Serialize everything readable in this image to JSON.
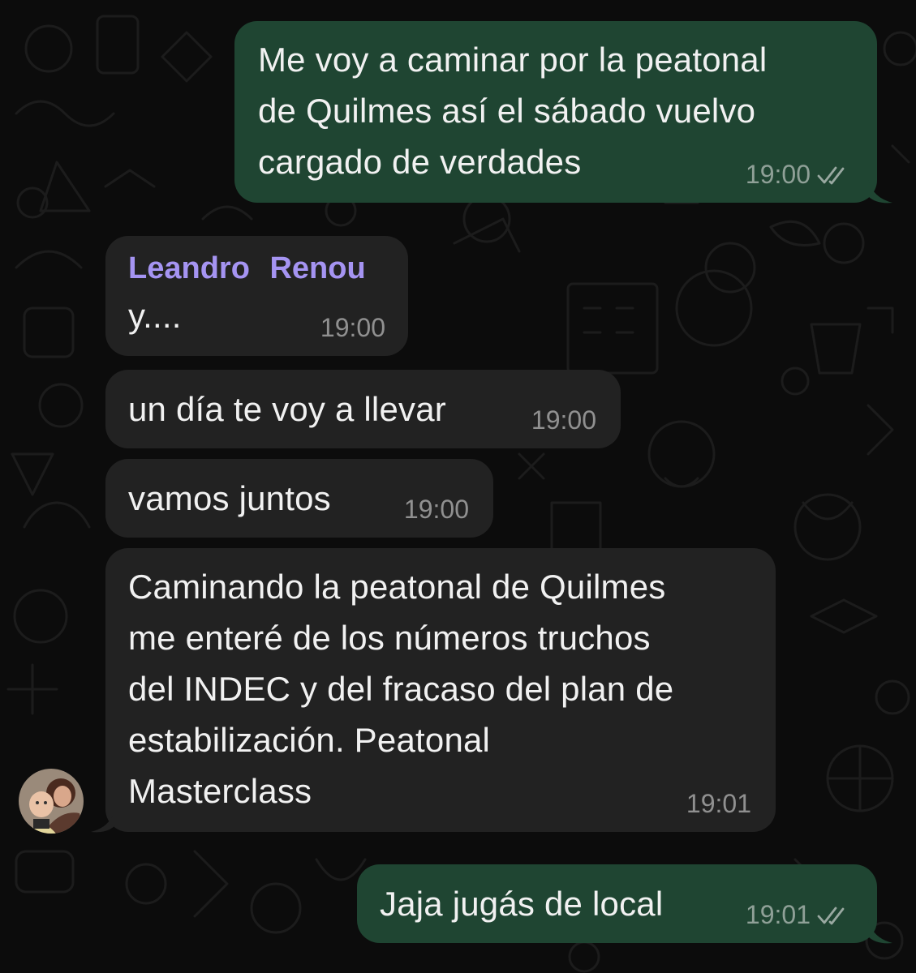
{
  "chat": {
    "messages": [
      {
        "direction": "outgoing",
        "text": "Me voy a caminar por la peatonal\nde Quilmes así el sábado vuelvo\ncargado de verdades",
        "time": "19:00",
        "status": "read-double-check-icon"
      },
      {
        "direction": "incoming",
        "sender": "Leandro  Renou",
        "text": "y....",
        "time": "19:00"
      },
      {
        "direction": "incoming",
        "text": "un día te voy a llevar",
        "time": "19:00"
      },
      {
        "direction": "incoming",
        "text": "vamos juntos",
        "time": "19:00"
      },
      {
        "direction": "incoming",
        "text": "Caminando la peatonal de Quilmes\nme enteré de los números truchos\ndel INDEC y del fracaso del plan de\nestabilización. Peatonal\nMasterclass",
        "time": "19:01",
        "avatar": "sender-avatar"
      },
      {
        "direction": "outgoing",
        "text": "Jaja jugás de local",
        "time": "19:01",
        "status": "read-double-check-icon"
      }
    ]
  },
  "colors": {
    "outgoing_bubble": "#1f4532",
    "incoming_bubble": "#222222",
    "sender_name": "#a594f2",
    "background": "#0c0c0c"
  }
}
